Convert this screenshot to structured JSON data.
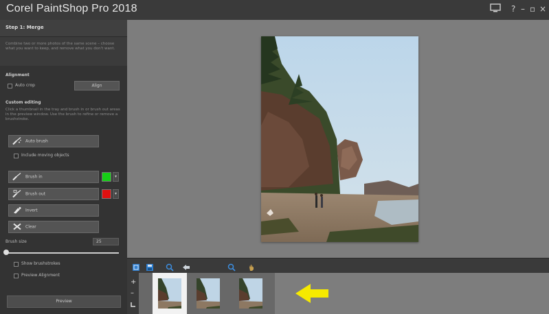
{
  "app": {
    "title": "Corel PaintShop Pro 2018"
  },
  "window_controls": {
    "help": "?",
    "minimize": "–",
    "restore": "▫",
    "close": "×"
  },
  "panel": {
    "step_title": "Step 1: Merge",
    "step_description": "Combine two or more photos of the same scene – choose what you want to keep, and remove what you don't want.",
    "alignment_label": "Alignment",
    "auto_crop_label": "Auto crop",
    "align_button": "Align",
    "custom_editing_label": "Custom editing",
    "custom_editing_hint": "Click a thumbnail in the tray and brush in or brush out areas in the preview window. Use the brush to refine or remove a brushstroke.",
    "auto_brush_button": "Auto brush",
    "include_moving_label": "Include moving objects",
    "brush_in_button": "Brush in",
    "brush_in_color": "#16d016",
    "brush_out_button": "Brush out",
    "brush_out_color": "#e01010",
    "invert_button": "Invert",
    "clear_button": "Clear",
    "brush_size_label": "Brush size",
    "brush_size_value": "25",
    "brush_size_fraction": 0.0,
    "show_brushstrokes_label": "Show brushstrokes",
    "preview_alignment_label": "Preview Alignment",
    "preview_button": "Preview"
  },
  "toolbar": {
    "icons": [
      "fit-window-icon",
      "save-icon",
      "zoom-out-icon",
      "pan-icon",
      "zoom-in-icon",
      "hand-icon"
    ]
  },
  "filmstrip": {
    "add_symbol": "+",
    "remove_symbol": "–",
    "thumbnails": [
      "photo-1",
      "photo-2",
      "photo-3"
    ],
    "selected_index": 0,
    "arrow_color": "#f6ea00"
  },
  "colors": {
    "accent_blue": "#2f7fd0",
    "canvas_bg": "#7d7d7d",
    "panel_bg": "#333333"
  }
}
